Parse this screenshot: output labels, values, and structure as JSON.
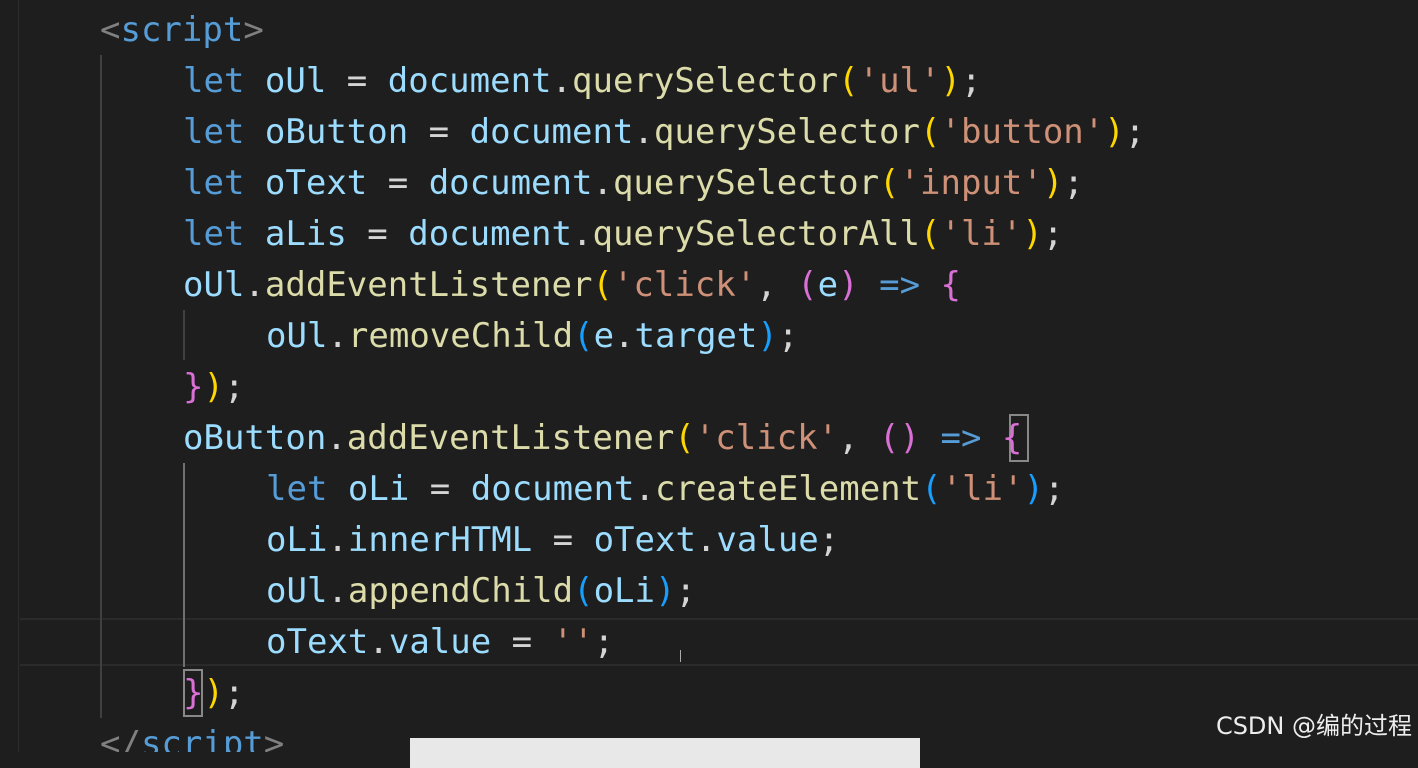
{
  "code": {
    "lines": [
      {
        "tokens": [
          [
            "tagb",
            "<"
          ],
          [
            "tag",
            "script"
          ],
          [
            "tagb",
            ">"
          ]
        ]
      },
      {
        "tokens": [
          [
            "kw",
            "let"
          ],
          [
            "op",
            " "
          ],
          [
            "var",
            "oUl"
          ],
          [
            "op",
            " = "
          ],
          [
            "var",
            "document"
          ],
          [
            "punc",
            "."
          ],
          [
            "fn",
            "querySelector"
          ],
          [
            "b1",
            "("
          ],
          [
            "str",
            "'ul'"
          ],
          [
            "b1",
            ")"
          ],
          [
            "punc",
            ";"
          ]
        ]
      },
      {
        "tokens": [
          [
            "kw",
            "let"
          ],
          [
            "op",
            " "
          ],
          [
            "var",
            "oButton"
          ],
          [
            "op",
            " = "
          ],
          [
            "var",
            "document"
          ],
          [
            "punc",
            "."
          ],
          [
            "fn",
            "querySelector"
          ],
          [
            "b1",
            "("
          ],
          [
            "str",
            "'button'"
          ],
          [
            "b1",
            ")"
          ],
          [
            "punc",
            ";"
          ]
        ]
      },
      {
        "tokens": [
          [
            "kw",
            "let"
          ],
          [
            "op",
            " "
          ],
          [
            "var",
            "oText"
          ],
          [
            "op",
            " = "
          ],
          [
            "var",
            "document"
          ],
          [
            "punc",
            "."
          ],
          [
            "fn",
            "querySelector"
          ],
          [
            "b1",
            "("
          ],
          [
            "str",
            "'input'"
          ],
          [
            "b1",
            ")"
          ],
          [
            "punc",
            ";"
          ]
        ]
      },
      {
        "tokens": [
          [
            "kw",
            "let"
          ],
          [
            "op",
            " "
          ],
          [
            "var",
            "aLis"
          ],
          [
            "op",
            " = "
          ],
          [
            "var",
            "document"
          ],
          [
            "punc",
            "."
          ],
          [
            "fn",
            "querySelectorAll"
          ],
          [
            "b1",
            "("
          ],
          [
            "str",
            "'li'"
          ],
          [
            "b1",
            ")"
          ],
          [
            "punc",
            ";"
          ]
        ]
      },
      {
        "tokens": [
          [
            "var",
            "oUl"
          ],
          [
            "punc",
            "."
          ],
          [
            "fn",
            "addEventListener"
          ],
          [
            "b1",
            "("
          ],
          [
            "str",
            "'click'"
          ],
          [
            "punc",
            ", "
          ],
          [
            "b2",
            "("
          ],
          [
            "var",
            "e"
          ],
          [
            "b2",
            ")"
          ],
          [
            "op",
            " "
          ],
          [
            "kw2",
            "=>"
          ],
          [
            "op",
            " "
          ],
          [
            "b2",
            "{"
          ]
        ]
      },
      {
        "tokens": [
          [
            "var",
            "oUl"
          ],
          [
            "punc",
            "."
          ],
          [
            "fn",
            "removeChild"
          ],
          [
            "b3",
            "("
          ],
          [
            "var",
            "e"
          ],
          [
            "punc",
            "."
          ],
          [
            "var",
            "target"
          ],
          [
            "b3",
            ")"
          ],
          [
            "punc",
            ";"
          ]
        ]
      },
      {
        "tokens": [
          [
            "b2",
            "}"
          ],
          [
            "b1",
            ")"
          ],
          [
            "punc",
            ";"
          ]
        ]
      },
      {
        "tokens": [
          [
            "var",
            "oButton"
          ],
          [
            "punc",
            "."
          ],
          [
            "fn",
            "addEventListener"
          ],
          [
            "b1",
            "("
          ],
          [
            "str",
            "'click'"
          ],
          [
            "punc",
            ", "
          ],
          [
            "b2",
            "()"
          ],
          [
            "op",
            " "
          ],
          [
            "kw2",
            "=>"
          ],
          [
            "op",
            " "
          ],
          [
            "b2",
            "{"
          ]
        ]
      },
      {
        "tokens": [
          [
            "kw",
            "let"
          ],
          [
            "op",
            " "
          ],
          [
            "var",
            "oLi"
          ],
          [
            "op",
            " = "
          ],
          [
            "var",
            "document"
          ],
          [
            "punc",
            "."
          ],
          [
            "fn",
            "createElement"
          ],
          [
            "b3",
            "("
          ],
          [
            "str",
            "'li'"
          ],
          [
            "b3",
            ")"
          ],
          [
            "punc",
            ";"
          ]
        ]
      },
      {
        "tokens": [
          [
            "var",
            "oLi"
          ],
          [
            "punc",
            "."
          ],
          [
            "var",
            "innerHTML"
          ],
          [
            "op",
            " = "
          ],
          [
            "var",
            "oText"
          ],
          [
            "punc",
            "."
          ],
          [
            "var",
            "value"
          ],
          [
            "punc",
            ";"
          ]
        ]
      },
      {
        "tokens": [
          [
            "var",
            "oUl"
          ],
          [
            "punc",
            "."
          ],
          [
            "fn",
            "appendChild"
          ],
          [
            "b3",
            "("
          ],
          [
            "var",
            "oLi"
          ],
          [
            "b3",
            ")"
          ],
          [
            "punc",
            ";"
          ]
        ]
      },
      {
        "tokens": [
          [
            "var",
            "oText"
          ],
          [
            "punc",
            "."
          ],
          [
            "var",
            "value"
          ],
          [
            "op",
            " = "
          ],
          [
            "str",
            "''"
          ],
          [
            "punc",
            ";"
          ]
        ]
      },
      {
        "tokens": [
          [
            "b2",
            "}"
          ],
          [
            "b1",
            ")"
          ],
          [
            "punc",
            ";"
          ]
        ]
      },
      {
        "tokens": [
          [
            "tagb",
            "</"
          ],
          [
            "tag",
            "script"
          ],
          [
            "tagb",
            ">"
          ]
        ]
      }
    ]
  },
  "watermark": "CSDN @编的过程",
  "colors": {
    "background": "#1e1e1e",
    "keyword": "#569cd6",
    "variable": "#9cdcfe",
    "function": "#dcdcaa",
    "string": "#ce9178",
    "bracket_level1": "#ffd700",
    "bracket_level2": "#da70d6",
    "bracket_level3": "#179fff"
  }
}
